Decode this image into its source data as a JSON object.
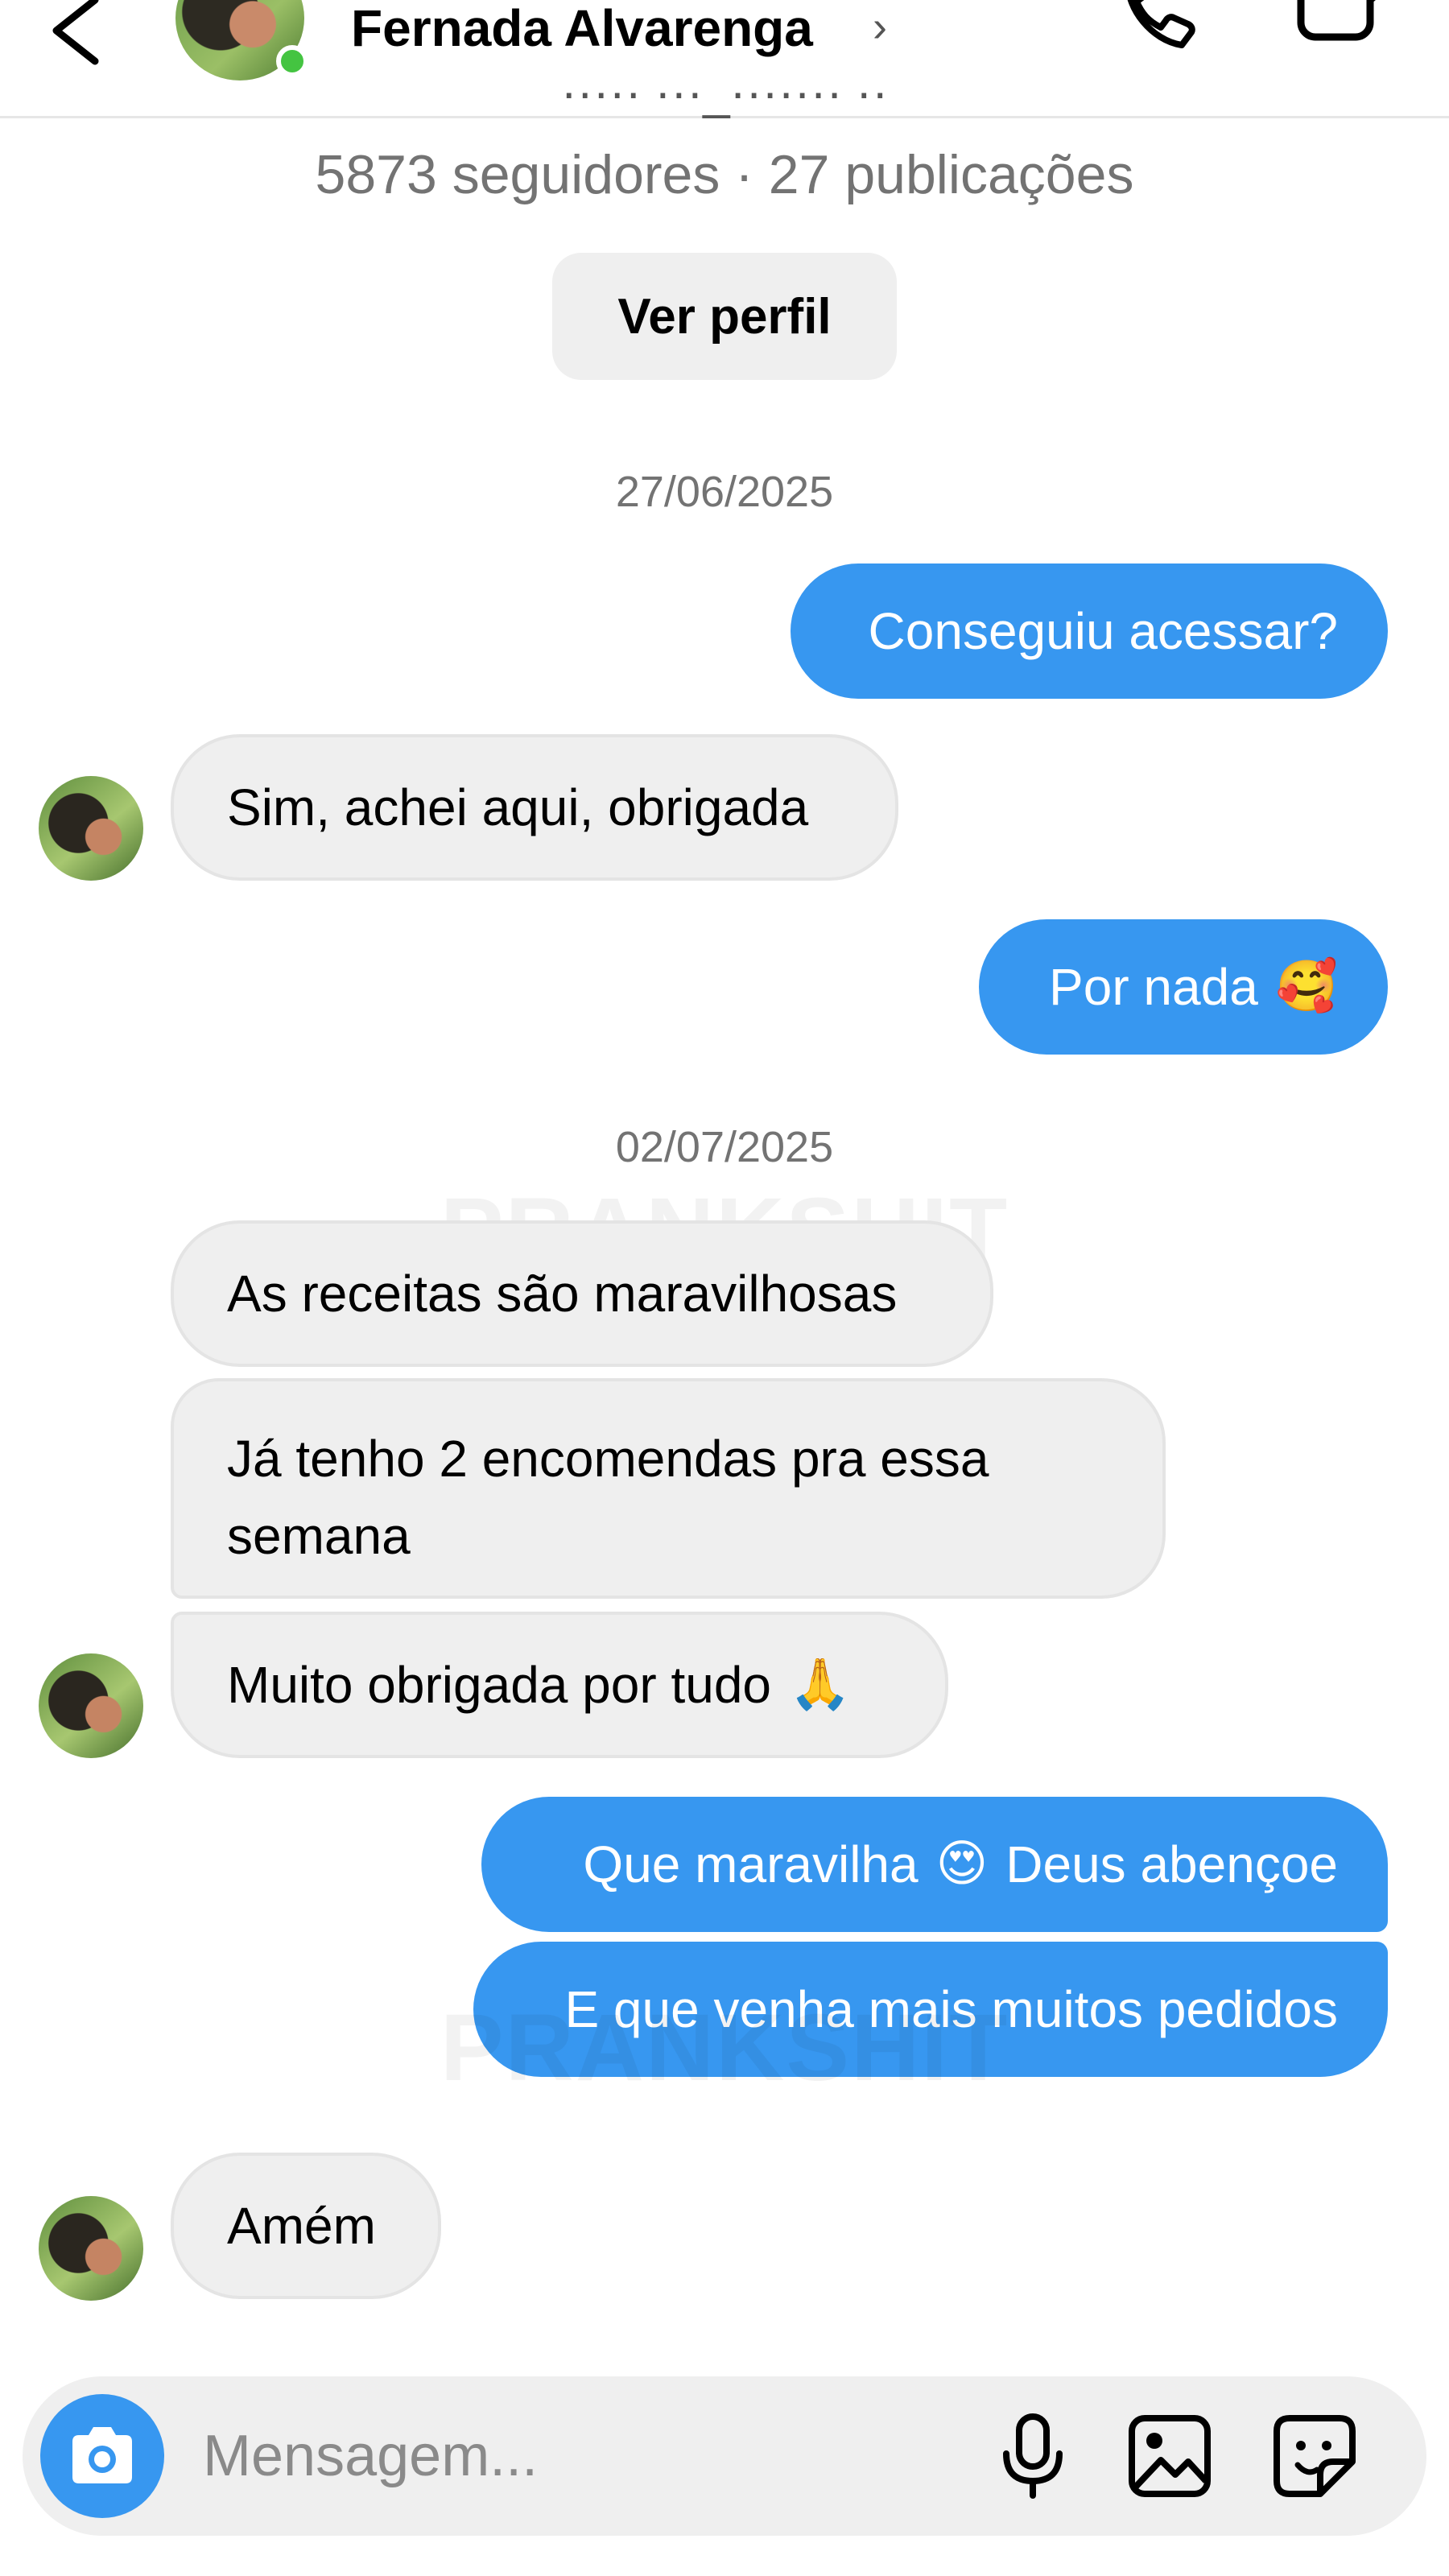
{
  "header": {
    "contact_name": "Fernada Alvarenga",
    "chevron": "›",
    "icons": [
      "back-arrow-icon",
      "phone-icon",
      "video-camera-icon"
    ],
    "online_color": "#44c441"
  },
  "profile": {
    "stats": "5873 seguidores · 27 publicações",
    "view_profile_label": "Ver perfil"
  },
  "messages": {
    "date_1": "27/06/2025",
    "out_1": "Conseguiu acessar?",
    "in_1": "Sim, achei aqui, obrigada",
    "out_2": "Por nada",
    "out_2_emoji": "🥰",
    "date_2": "02/07/2025",
    "in_2": "As receitas são maravilhosas",
    "in_3": "Já tenho 2 encomendas pra essa semana",
    "in_4": "Muito obrigada por tudo",
    "in_4_emoji": "🙏",
    "out_3_a": "Que maravilha",
    "out_3_emoji": "😍",
    "out_3_b": "Deus abençoe",
    "out_4": "E que venha mais muitos pedidos",
    "in_5": "Amém"
  },
  "watermark": "PRANKSHIT",
  "composer": {
    "placeholder": "Mensagem...",
    "icons": [
      "camera-icon",
      "microphone-icon",
      "gallery-icon",
      "sticker-icon"
    ]
  },
  "colors": {
    "outgoing_bubble": "#3797f0",
    "incoming_bubble": "#efefef",
    "muted_text": "#737373"
  }
}
